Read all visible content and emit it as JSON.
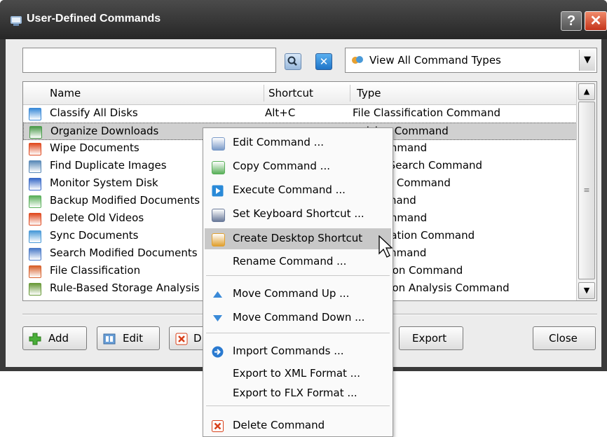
{
  "window": {
    "title": "User-Defined Commands",
    "help_label": "?",
    "close_label": "✕"
  },
  "search": {
    "value": "",
    "placeholder": ""
  },
  "type_filter": {
    "selected": "View All Command Types"
  },
  "columns": {
    "name": "Name",
    "shortcut": "Shortcut",
    "type": "Type"
  },
  "rows": [
    {
      "name": "Classify All Disks",
      "shortcut": "Alt+C",
      "type": "File Classification Command",
      "icon": "pie-chart-icon",
      "color": "#3a8ad8"
    },
    {
      "name": "Organize Downloads",
      "shortcut": "",
      "type": "anizing Command",
      "icon": "organize-icon",
      "color": "#4a9a4a"
    },
    {
      "name": "Wipe Documents",
      "shortcut": "",
      "type": "ete Command",
      "icon": "delete-icon",
      "color": "#e04a20"
    },
    {
      "name": "Find Duplicate Images",
      "shortcut": "",
      "type": "e Files Search Command",
      "icon": "duplicates-icon",
      "color": "#5a8ab8"
    },
    {
      "name": "Monitor System Disk",
      "shortcut": "",
      "type": "nitoring Command",
      "icon": "monitor-icon",
      "color": "#3a6ac8"
    },
    {
      "name": "Backup Modified Documents",
      "shortcut": "",
      "type": "y Command",
      "icon": "copy-icon",
      "color": "#5ab05a"
    },
    {
      "name": "Delete Old Videos",
      "shortcut": "",
      "type": "ete Command",
      "icon": "delete-icon",
      "color": "#e04a20"
    },
    {
      "name": "Sync Documents",
      "shortcut": "",
      "type": "chronization Command",
      "icon": "sync-icon",
      "color": "#4a9ad8"
    },
    {
      "name": "Search Modified Documents",
      "shortcut": "",
      "type": "rch Command",
      "icon": "search-icon",
      "color": "#4a7ac8"
    },
    {
      "name": "File Classification",
      "shortcut": "",
      "type": "ssification Command",
      "icon": "pie-chart-icon",
      "color": "#d8602a"
    },
    {
      "name": "Rule-Based Storage Analysis",
      "shortcut": "",
      "type": "Utilization Analysis Command",
      "icon": "analysis-icon",
      "color": "#6a9a3a"
    }
  ],
  "buttons": {
    "add": "Add",
    "edit": "Edit",
    "delete_partial": "D",
    "export": "Export",
    "close": "Close"
  },
  "context_menu": {
    "items": [
      {
        "label": "Edit Command ...",
        "icon": "edit-icon"
      },
      {
        "label": "Copy Command ...",
        "icon": "copy-icon"
      },
      {
        "label": "Execute Command ...",
        "icon": "play-icon"
      },
      {
        "label": "Set Keyboard Shortcut ...",
        "icon": "keyboard-icon"
      },
      {
        "label": "Create Desktop Shortcut",
        "icon": "desktop-shortcut-icon"
      },
      {
        "label": "Rename Command ...",
        "icon": ""
      },
      {
        "label": "Move Command Up ...",
        "icon": "arrow-up-icon"
      },
      {
        "label": "Move Command Down ...",
        "icon": "arrow-down-icon"
      },
      {
        "label": "Import Commands ...",
        "icon": "import-icon"
      },
      {
        "label": "Export to XML Format ...",
        "icon": ""
      },
      {
        "label": "Export to FLX Format ...",
        "icon": ""
      },
      {
        "label": "Delete Command",
        "icon": "delete-icon"
      }
    ],
    "highlighted": "Create Desktop Shortcut"
  },
  "colors": {
    "title_bar": "#2e2e2e",
    "accent_blue": "#2a7ad0",
    "danger": "#d8401a",
    "selection": "#d0d0d0"
  }
}
